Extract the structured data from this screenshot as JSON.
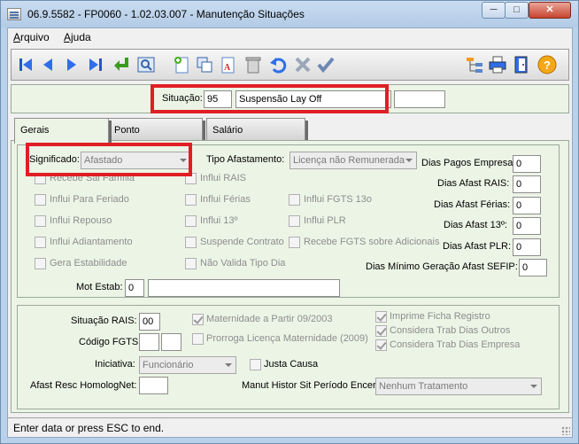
{
  "window": {
    "title": "06.9.5582 - FP0060 - 1.02.03.007 - Manutenção Situações",
    "min_glyph": "─",
    "max_glyph": "□",
    "close_glyph": "✕"
  },
  "menu": [
    {
      "first": "A",
      "rest": "rquivo"
    },
    {
      "first": "Aj",
      "rest": "uda"
    }
  ],
  "toolbar": {
    "icons": [
      "first-record-icon",
      "prev-record-icon",
      "next-record-icon",
      "last-record-icon",
      "return-icon",
      "search-icon",
      "add-record-icon",
      "copy-record-icon",
      "rename-icon",
      "delete-icon",
      "undo-icon",
      "cancel-icon",
      "confirm-icon",
      "tree-icon",
      "print-icon",
      "exit-icon",
      "help-icon"
    ]
  },
  "header": {
    "situacao_label": "Situação:",
    "situacao_code": "95",
    "situacao_desc": "Suspensão Lay Off",
    "extra_value": ""
  },
  "tabs": [
    {
      "label": "Gerais",
      "active": true
    },
    {
      "label": "Ponto",
      "active": false
    },
    {
      "label": "Salário",
      "active": false
    }
  ],
  "gerais": {
    "significado_label": "Significado:",
    "significado_value": "Afastado",
    "tipo_afastamento_label": "Tipo Afastamento:",
    "tipo_afastamento_value": "Licença não Remunerada",
    "checkboxes": {
      "recebe_sal_familia": "Recebe Sal Família",
      "influi_rais": "Influi RAIS",
      "influi_feriado": "Influi Para Feriado",
      "influi_ferias": "Influi Férias",
      "influi_fgts13": "Influi FGTS 13o",
      "influi_repouso": "Influi Repouso",
      "influi_13": "Influi 13º",
      "influi_plr": "Influi PLR",
      "influi_adiantamento": "Influi Adiantamento",
      "suspende_contrato": "Suspende Contrato",
      "recebe_fgts_adicionais": "Recebe FGTS sobre Adicionais",
      "gera_estabilidade": "Gera Estabilidade",
      "nao_valida_tipo_dia": "Não Valida Tipo Dia"
    },
    "dias": {
      "pagos_empresa_label": "Dias Pagos Empresa:",
      "pagos_empresa_value": "0",
      "afast_rais_label": "Dias Afast RAIS:",
      "afast_rais_value": "0",
      "afast_ferias_label": "Dias Afast Férias:",
      "afast_ferias_value": "0",
      "afast_13_label": "Dias Afast 13º:",
      "afast_13_value": "0",
      "afast_plr_label": "Dias Afast PLR:",
      "afast_plr_value": "0",
      "minimo_sefip_label": "Dias Mínimo Geração Afast SEFIP:",
      "minimo_sefip_value": "0"
    },
    "mot_estab_label": "Mot Estab:",
    "mot_estab_code": "0",
    "mot_estab_desc": ""
  },
  "bottom": {
    "situacao_rais_label": "Situação RAIS:",
    "situacao_rais_value": "00",
    "codigo_fgts_label": "Código FGTS:",
    "codigo_fgts_1": "",
    "codigo_fgts_2": "",
    "iniciativa_label": "Iniciativa:",
    "iniciativa_value": "Funcionário",
    "afast_resc_label": "Afast Resc HomologNet:",
    "afast_resc_value": "",
    "maternidade_label": "Maternidade a Partir 09/2003",
    "prorroga_label": "Prorroga Licença Maternidade (2009)",
    "justa_causa_label": "Justa Causa",
    "imprime_ficha_label": "Imprime Ficha Registro",
    "considera_outros_label": "Considera Trab Dias Outros",
    "considera_empresa_label": "Considera Trab Dias Empresa",
    "manut_histor_label": "Manut Histor Sit Período Encer:",
    "manut_histor_value": "Nenhum Tratamento"
  },
  "status": {
    "text": "Enter data or press ESC to end."
  }
}
